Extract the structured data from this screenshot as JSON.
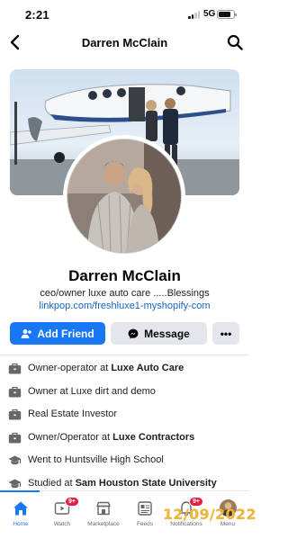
{
  "status_bar": {
    "time": "2:21",
    "network": "5G"
  },
  "header": {
    "title": "Darren McClain"
  },
  "profile": {
    "name": "Darren McClain",
    "bio": "ceo/owner luxe auto care .....Blessings",
    "link": "linkpop.com/freshluxe1-myshopify-com"
  },
  "actions": {
    "add_friend": "Add Friend",
    "message": "Message",
    "more": "•••"
  },
  "details": [
    {
      "icon": "briefcase-icon",
      "prefix": "Owner-operator at ",
      "bold": "Luxe Auto Care"
    },
    {
      "icon": "briefcase-icon",
      "prefix": "Owner at Luxe  dirt and demo",
      "bold": ""
    },
    {
      "icon": "briefcase-icon",
      "prefix": "Real Estate Investor",
      "bold": ""
    },
    {
      "icon": "briefcase-icon",
      "prefix": "Owner/Operator at ",
      "bold": "Luxe Contractors"
    },
    {
      "icon": "graduation-cap-icon",
      "prefix": "Went to Huntsville High School",
      "bold": ""
    },
    {
      "icon": "graduation-cap-icon",
      "prefix": "Studied at ",
      "bold": "Sam Houston State University"
    }
  ],
  "tabbar": {
    "home": "Home",
    "watch": "Watch",
    "watch_badge": "9+",
    "marketplace": "Marketplace",
    "feeds": "Feeds",
    "notifications": "Notifications",
    "notifications_badge": "9+",
    "menu": "Menu"
  },
  "overlay": {
    "date_stamp": "12/09/2022",
    "color": "#f2b431"
  },
  "colors": {
    "accent": "#1877f2",
    "secondary_button": "#e4e6eb",
    "badge": "#e41e3f"
  }
}
